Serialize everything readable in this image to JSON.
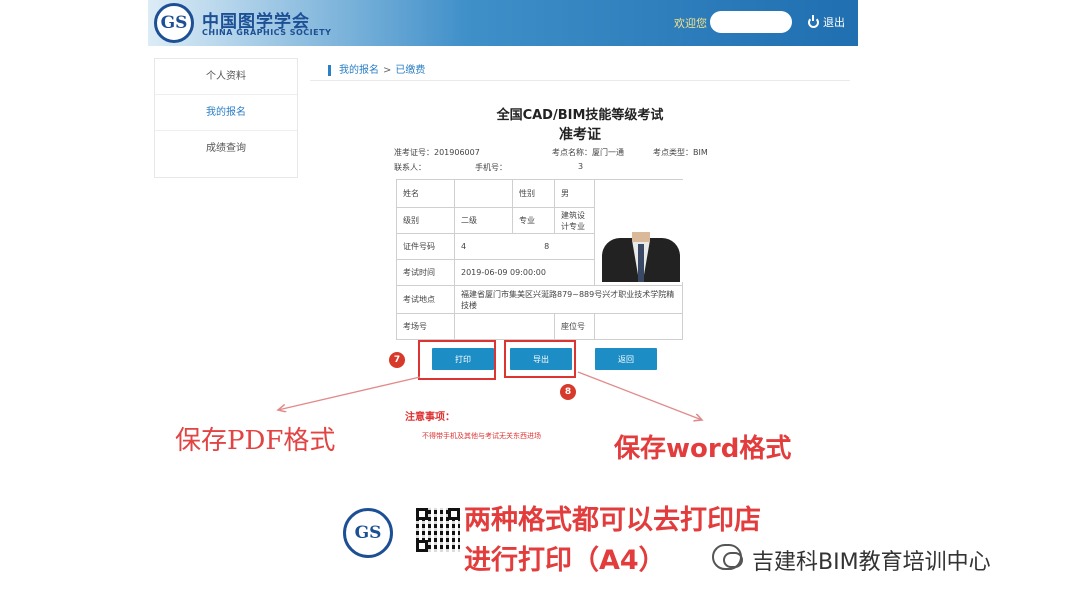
{
  "header": {
    "logo_text": "GS",
    "org_name_cn": "中国图学学会",
    "org_name_en": "CHINA GRAPHICS SOCIETY",
    "welcome": "欢迎您",
    "logout_label": "退出"
  },
  "sidebar": {
    "items": [
      {
        "label": "个人资料"
      },
      {
        "label": "我的报名"
      },
      {
        "label": "成绩查询"
      }
    ]
  },
  "breadcrumb": {
    "first": "我的报名",
    "separator": ">",
    "current": "已缴费"
  },
  "certificate": {
    "title": "全国CAD/BIM技能等级考试",
    "subtitle": "准考证",
    "exam_no_label": "准考证号：",
    "exam_no": "201906007",
    "center_label": "考点名称：",
    "center_value": "厦门一通",
    "center_type_label": "考点类型：",
    "center_type_value": "BIM",
    "contact_label": "联系人：",
    "phone_label": "手机号：",
    "phone_value": "3",
    "rows": {
      "name_label": "姓名",
      "gender_label": "性别",
      "gender_value": "男",
      "level_label": "级别",
      "level_value": "二级",
      "major_label": "专业",
      "major_value": "建筑设计专业",
      "id_label": "证件号码",
      "id_value_start": "4",
      "id_value_end": "8",
      "time_label": "考试时间",
      "time_value": "2019-06-09 09:00:00",
      "place_label": "考试地点",
      "place_value": "福建省厦门市集美区兴涎路879~889号兴才职业技术学院精技楼",
      "room_label": "考场号",
      "seat_label": "座位号"
    }
  },
  "buttons": {
    "print": "打印",
    "export": "导出",
    "back": "返回"
  },
  "badges": {
    "print_step": "7",
    "export_step": "8"
  },
  "notice": {
    "title": "注意事项：",
    "text": "不得带手机及其他与考试无关东西进场"
  },
  "annotations": {
    "pdf": "保存PDF格式",
    "word": "保存word格式",
    "bottom_line1": "两种格式都可以去打印店",
    "bottom_line2": "进行打印（A4）"
  },
  "watermark": "吉建科BIM教育培训中心",
  "colors": {
    "accent": "#1c8ec5",
    "annotation_red": "#e24444",
    "header_blue": "#1f6fb1"
  }
}
